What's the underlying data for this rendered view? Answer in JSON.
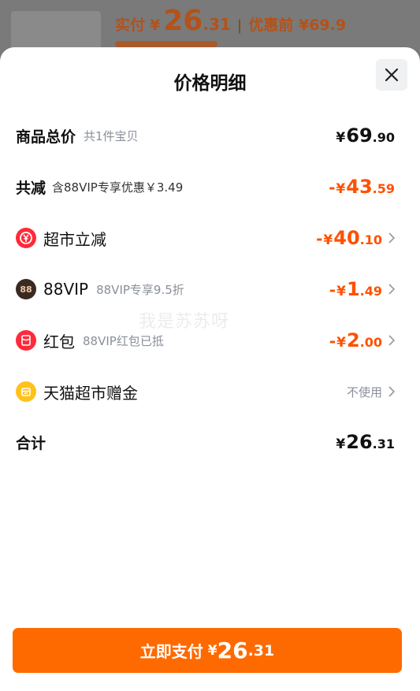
{
  "background": {
    "price_label": "实付",
    "currency": "¥",
    "price_int": "26",
    "price_dec": ".31",
    "separator": "|",
    "original_label": "优惠前 ¥69.9"
  },
  "sheet": {
    "title": "价格明细",
    "close_icon": "close-icon",
    "rows": {
      "total": {
        "label": "商品总价",
        "sub": "共1件宝贝",
        "currency": "¥",
        "int": "69",
        "dec": ".90"
      },
      "reduction": {
        "label": "共减",
        "sub": "含88VIP专享优惠￥3.49",
        "neg": "-",
        "currency": "¥",
        "int": "43",
        "dec": ".59"
      },
      "supermarket": {
        "icon": "supermarket-discount-icon",
        "label": "超市立减",
        "neg": "-",
        "currency": "¥",
        "int": "40",
        "dec": ".10"
      },
      "vip": {
        "icon": "88vip-icon",
        "icon_text": "88",
        "label": "88VIP",
        "sub": "88VIP专享9.5折",
        "neg": "-",
        "currency": "¥",
        "int": "1",
        "dec": ".49"
      },
      "redpacket": {
        "icon": "red-packet-icon",
        "label": "红包",
        "sub": "88VIP红包已抵",
        "neg": "-",
        "currency": "¥",
        "int": "2",
        "dec": ".00"
      },
      "gift": {
        "icon": "gift-money-icon",
        "label": "天猫超市赠金",
        "value": "不使用"
      },
      "sum": {
        "label": "合计",
        "currency": "¥",
        "int": "26",
        "dec": ".31"
      }
    },
    "watermark": "我是苏苏呀",
    "pay_button": {
      "label": "立即支付",
      "currency": "¥",
      "int": "26",
      "dec": ".31"
    }
  },
  "colors": {
    "accent": "#ff5000",
    "button": "#ff6a00",
    "muted": "#8a8f99"
  }
}
